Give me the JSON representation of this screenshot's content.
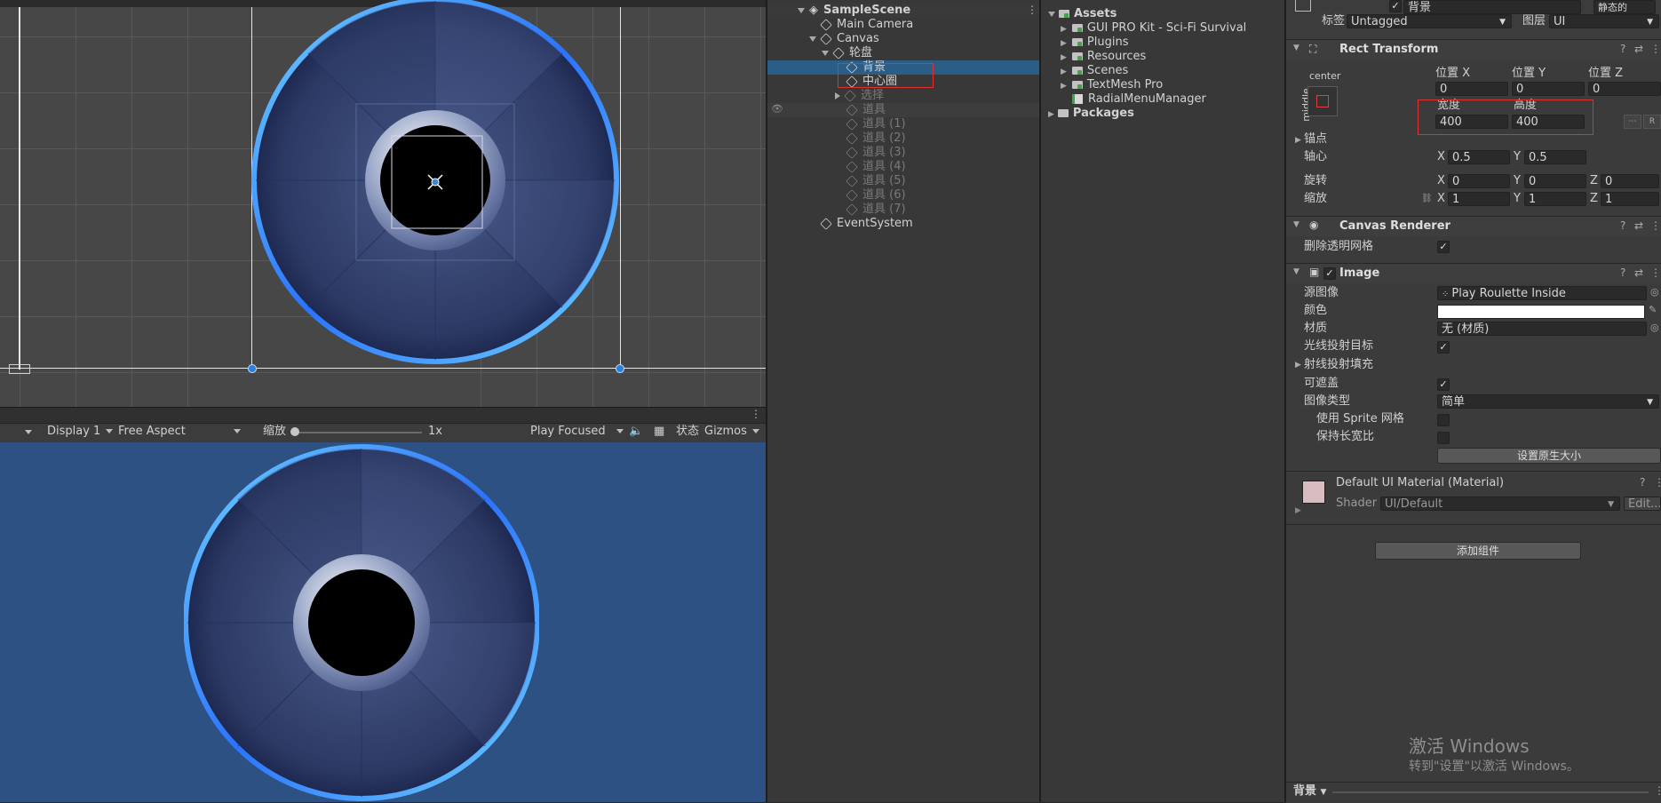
{
  "scene_view": {
    "object_size": "400"
  },
  "game_toolbar": {
    "display": "Display 1",
    "aspect": "Free Aspect",
    "scale_label": "缩放",
    "scale_value": "1x",
    "play_mode": "Play Focused",
    "stats": "状态",
    "gizmos": "Gizmos"
  },
  "hierarchy": {
    "scene": "SampleScene",
    "items": [
      {
        "label": "Main Camera"
      },
      {
        "label": "Canvas"
      },
      {
        "label": "轮盘"
      },
      {
        "label": "背景"
      },
      {
        "label": "中心圈"
      },
      {
        "label": "选择"
      },
      {
        "label": "道具"
      },
      {
        "label": "道具 (1)"
      },
      {
        "label": "道具 (2)"
      },
      {
        "label": "道具 (3)"
      },
      {
        "label": "道具 (4)"
      },
      {
        "label": "道具 (5)"
      },
      {
        "label": "道具 (6)"
      },
      {
        "label": "道具 (7)"
      },
      {
        "label": "EventSystem"
      }
    ]
  },
  "project": {
    "root": "Assets",
    "items": [
      "GUI PRO Kit - Sci-Fi Survival",
      "Plugins",
      "Resources",
      "Scenes",
      "TextMesh Pro",
      "RadialMenuManager"
    ],
    "packages": "Packages"
  },
  "inspector": {
    "object_name": "背景",
    "static_label": "静态的",
    "tag_label": "标签",
    "tag_value": "Untagged",
    "layer_label": "图层",
    "layer_value": "UI",
    "rect_transform": {
      "title": "Rect Transform",
      "anchor_h": "center",
      "anchor_v": "middle",
      "pos_x_label": "位置 X",
      "pos_x": "0",
      "pos_y_label": "位置 Y",
      "pos_y": "0",
      "pos_z_label": "位置 Z",
      "pos_z": "0",
      "width_label": "宽度",
      "width": "400",
      "height_label": "高度",
      "height": "400",
      "anchors_label": "锚点",
      "pivot_label": "轴心",
      "pivot_x": "0.5",
      "pivot_y": "0.5",
      "rotation_label": "旋转",
      "rot_x": "0",
      "rot_y": "0",
      "rot_z": "0",
      "scale_label": "缩放",
      "scale_x": "1",
      "scale_y": "1",
      "scale_z": "1",
      "x": "X",
      "y": "Y",
      "z": "Z",
      "r": "R"
    },
    "canvas_renderer": {
      "title": "Canvas Renderer",
      "cull_label": "删除透明网格",
      "cull_checked": "✓"
    },
    "image": {
      "title": "Image",
      "enabled": "✓",
      "source_label": "源图像",
      "source_value": "Play Roulette Inside",
      "color_label": "颜色",
      "material_label": "材质",
      "material_value": "无 (材质)",
      "raycast_target_label": "光线投射目标",
      "raycast_target": "✓",
      "raycast_padding_label": "射线投射填充",
      "maskable_label": "可遮盖",
      "maskable": "✓",
      "image_type_label": "图像类型",
      "image_type_value": "简单",
      "use_sprite_mesh_label": "使用 Sprite 网格",
      "preserve_aspect_label": "保持长宽比",
      "native_size_button": "设置原生大小"
    },
    "material": {
      "name": "Default UI Material (Material)",
      "shader_label": "Shader",
      "shader_value": "UI/Default",
      "edit_button": "Edit..."
    },
    "add_component": "添加组件",
    "footer_name": "背景",
    "activate_title": "激活 Windows",
    "activate_sub": "转到\"设置\"以激活 Windows。"
  },
  "colors": {
    "selection": "#2c5d87",
    "highlight_box": "#e03030",
    "game_bg": "#2d5182",
    "ring_blue": "#3a8cff"
  }
}
